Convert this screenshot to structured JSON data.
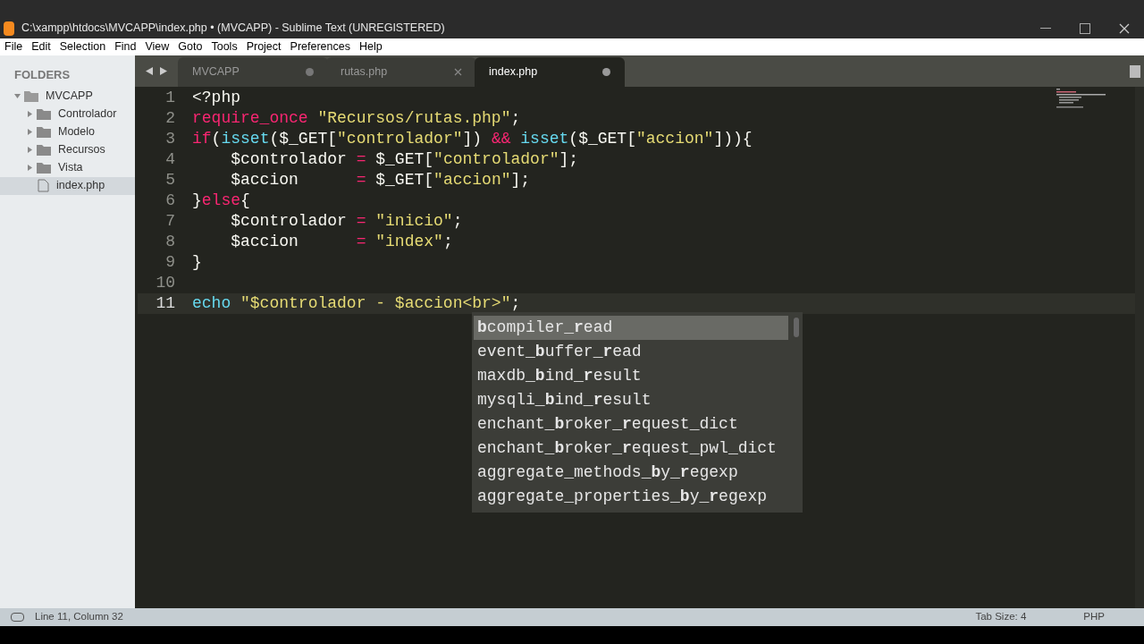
{
  "window": {
    "title": "C:\\xampp\\htdocs\\MVCAPP\\index.php • (MVCAPP) - Sublime Text (UNREGISTERED)"
  },
  "menu": [
    "File",
    "Edit",
    "Selection",
    "Find",
    "View",
    "Goto",
    "Tools",
    "Project",
    "Preferences",
    "Help"
  ],
  "sidebar": {
    "heading": "FOLDERS",
    "tree": [
      {
        "label": "MVCAPP",
        "kind": "folder",
        "expanded": true,
        "selected": false,
        "children": [
          {
            "label": "Controlador",
            "kind": "folder",
            "expanded": false,
            "selected": false
          },
          {
            "label": "Modelo",
            "kind": "folder",
            "expanded": false,
            "selected": false
          },
          {
            "label": "Recursos",
            "kind": "folder",
            "expanded": false,
            "selected": false
          },
          {
            "label": "Vista",
            "kind": "folder",
            "expanded": false,
            "selected": false
          },
          {
            "label": "index.php",
            "kind": "file",
            "expanded": false,
            "selected": true
          }
        ]
      }
    ]
  },
  "tabs": [
    {
      "label": "MVCAPP",
      "selected": false,
      "modified": true
    },
    {
      "label": "rutas.php",
      "selected": false,
      "modified": false
    },
    {
      "label": "index.php",
      "selected": true,
      "modified": true
    }
  ],
  "editor": {
    "lines": [
      {
        "number": "1",
        "current": false,
        "tokens": [
          {
            "kind": "plain",
            "text": "<?php"
          }
        ]
      },
      {
        "number": "2",
        "current": false,
        "tokens": [
          {
            "kind": "keyword",
            "text": "require_once"
          },
          {
            "kind": "string",
            "text": " \"Recursos/rutas.php\""
          },
          {
            "kind": "plain",
            "text": ";"
          }
        ]
      },
      {
        "number": "3",
        "current": false,
        "tokens": [
          {
            "kind": "keyword",
            "text": "if"
          },
          {
            "kind": "plain",
            "text": "("
          },
          {
            "kind": "function",
            "text": "isset"
          },
          {
            "kind": "plain",
            "text": "($_GET["
          },
          {
            "kind": "string",
            "text": "\"controlador\""
          },
          {
            "kind": "plain",
            "text": "]) "
          },
          {
            "kind": "keyword",
            "text": "&&"
          },
          {
            "kind": "function",
            "text": " isset"
          },
          {
            "kind": "plain",
            "text": "($_GET["
          },
          {
            "kind": "string",
            "text": "\"accion\""
          },
          {
            "kind": "plain",
            "text": "])){"
          }
        ]
      },
      {
        "number": "4",
        "current": false,
        "tokens": [
          {
            "kind": "plain",
            "text": "    $controlador "
          },
          {
            "kind": "keyword",
            "text": "="
          },
          {
            "kind": "plain",
            "text": " $_GET["
          },
          {
            "kind": "string",
            "text": "\"controlador\""
          },
          {
            "kind": "plain",
            "text": "];"
          }
        ]
      },
      {
        "number": "5",
        "current": false,
        "tokens": [
          {
            "kind": "plain",
            "text": "    $accion      "
          },
          {
            "kind": "keyword",
            "text": "="
          },
          {
            "kind": "plain",
            "text": " $_GET["
          },
          {
            "kind": "string",
            "text": "\"accion\""
          },
          {
            "kind": "plain",
            "text": "];"
          }
        ]
      },
      {
        "number": "6",
        "current": false,
        "tokens": [
          {
            "kind": "plain",
            "text": "}"
          },
          {
            "kind": "keyword",
            "text": "else"
          },
          {
            "kind": "plain",
            "text": "{"
          }
        ]
      },
      {
        "number": "7",
        "current": false,
        "tokens": [
          {
            "kind": "plain",
            "text": "    $controlador "
          },
          {
            "kind": "keyword",
            "text": "="
          },
          {
            "kind": "string",
            "text": " \"inicio\""
          },
          {
            "kind": "plain",
            "text": ";"
          }
        ]
      },
      {
        "number": "8",
        "current": false,
        "tokens": [
          {
            "kind": "plain",
            "text": "    $accion      "
          },
          {
            "kind": "keyword",
            "text": "="
          },
          {
            "kind": "string",
            "text": " \"index\""
          },
          {
            "kind": "plain",
            "text": ";"
          }
        ]
      },
      {
        "number": "9",
        "current": false,
        "tokens": [
          {
            "kind": "plain",
            "text": "}"
          }
        ]
      },
      {
        "number": "10",
        "current": false
      },
      {
        "number": "11",
        "current": true,
        "tokens": [
          {
            "kind": "function",
            "text": "echo"
          },
          {
            "kind": "string",
            "text": " \"$controlador - $accion<br>\""
          },
          {
            "kind": "plain",
            "text": ";"
          }
        ]
      }
    ]
  },
  "autocomplete": [
    {
      "text": "**b**compiler_**r**ead",
      "selected": true
    },
    {
      "text": "event_**b**uffer_**r**ead",
      "selected": false
    },
    {
      "text": "maxdb_**b**ind_**r**esult",
      "selected": false
    },
    {
      "text": "mysqli_**b**ind_**r**esult",
      "selected": false
    },
    {
      "text": "enchant_**b**roker_**r**equest_dict",
      "selected": false
    },
    {
      "text": "enchant_**b**roker_**r**equest_pwl_dict",
      "selected": false
    },
    {
      "text": "aggregate_methods_**b**y_**r**egexp",
      "selected": false
    },
    {
      "text": "aggregate_properties_**b**y_**r**egexp",
      "selected": false
    }
  ],
  "status_bar": {
    "position": "Line 11, Column 32",
    "tab_size": "Tab Size: 4",
    "syntax": "PHP"
  }
}
